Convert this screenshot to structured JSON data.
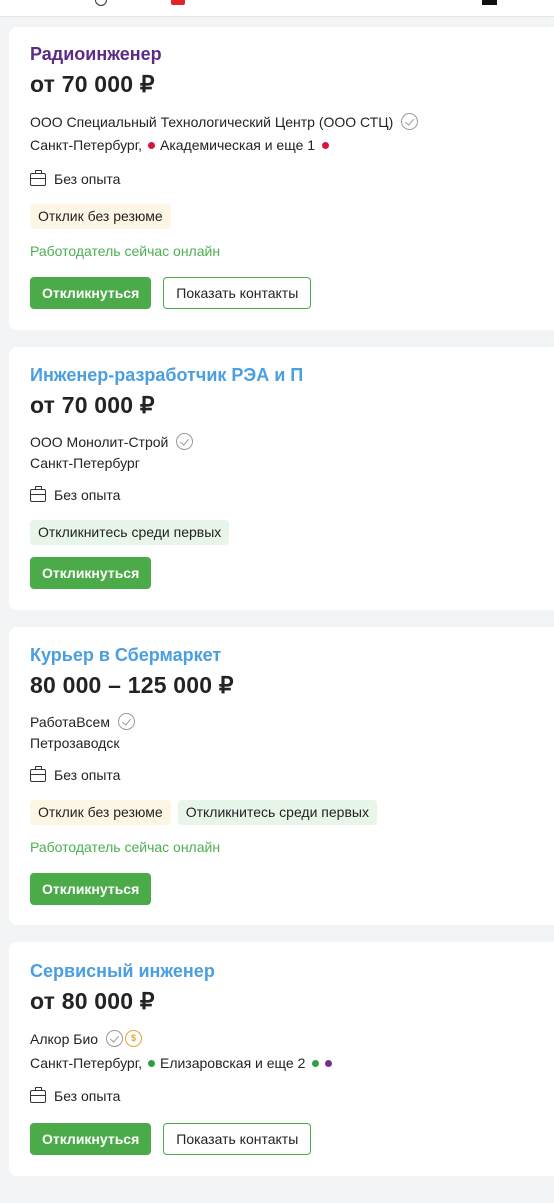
{
  "colors": {
    "title_link": "#4a9fe0",
    "title_visited": "#5b2b86",
    "primary_button": "#4bab48",
    "online_text": "#4caf50",
    "tag_yellow": "#fdf6e4",
    "tag_green": "#e8f5e9"
  },
  "vacancies": [
    {
      "title": "Радиоинженер",
      "salary": "от 70 000 ₽",
      "company": "ООО Специальный Технологический Центр (ООО СТЦ)",
      "city": "Санкт-Петербург,",
      "metro": "Академическая и еще 1",
      "metro_colors": [
        "#d6173a",
        "#d6173a"
      ],
      "experience": "Без опыта",
      "tags": [
        "Отклик без резюме"
      ],
      "online": "Работодатель сейчас онлайн",
      "respond_label": "Откликнуться",
      "contacts_label": "Показать контакты"
    },
    {
      "title": "Инженер-разработчик РЭА и П",
      "salary": "от 70 000 ₽",
      "company": "ООО Монолит-Строй",
      "city": "Санкт-Петербург",
      "experience": "Без опыта",
      "tags": [
        "Откликнитесь среди первых"
      ],
      "respond_label": "Откликнуться"
    },
    {
      "title": "Курьер в Сбермаркет",
      "salary": "80 000 – 125 000 ₽",
      "company": "РаботаВсем",
      "city": "Петрозаводск",
      "experience": "Без опыта",
      "tags": [
        "Отклик без резюме",
        "Откликнитесь среди первых"
      ],
      "online": "Работодатель сейчас онлайн",
      "respond_label": "Откликнуться"
    },
    {
      "title": "Сервисный инженер",
      "salary": "от 80 000 ₽",
      "company": "Алкор Био",
      "city": "Санкт-Петербург,",
      "metro": "Елизаровская и еще 2",
      "metro_colors": [
        "#2f9e44",
        "#2f9e44",
        "#7b2d8e"
      ],
      "experience": "Без опыта",
      "respond_label": "Откликнуться",
      "contacts_label": "Показать контакты"
    }
  ]
}
